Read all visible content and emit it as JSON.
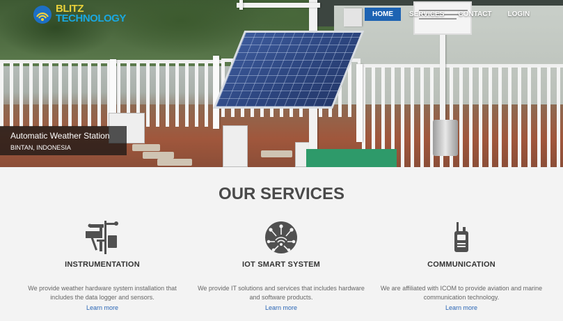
{
  "brand": {
    "line1": "BLITZ",
    "line2": "TECHNOLOGY"
  },
  "nav": {
    "items": [
      {
        "label": "HOME",
        "active": true
      },
      {
        "label": "SERVICES",
        "active": false
      },
      {
        "label": "CONTACT",
        "active": false
      },
      {
        "label": "LOGIN",
        "active": false
      }
    ]
  },
  "hero": {
    "title": "Automatic Weather Station",
    "subtitle": "BINTAN, INDONESIA"
  },
  "services": {
    "heading": "OUR SERVICES",
    "cards": [
      {
        "icon": "weather-station-icon",
        "title": "INSTRUMENTATION",
        "description": "We provide weather hardware system installation that includes the data logger and sensors.",
        "link": "Learn more"
      },
      {
        "icon": "iot-network-icon",
        "title": "IOT SMART SYSTEM",
        "description": "We provide IT solutions and services that includes hardware and software products.",
        "link": "Learn more"
      },
      {
        "icon": "walkie-talkie-icon",
        "title": "COMMUNICATION",
        "description": "We are affiliated with ICOM to provide aviation and marine communication technology.",
        "link": "Learn more"
      }
    ]
  },
  "colors": {
    "nav_active": "#1d63b3",
    "link": "#2c67b6",
    "heading": "#4a4a4a",
    "icon": "#505050"
  }
}
